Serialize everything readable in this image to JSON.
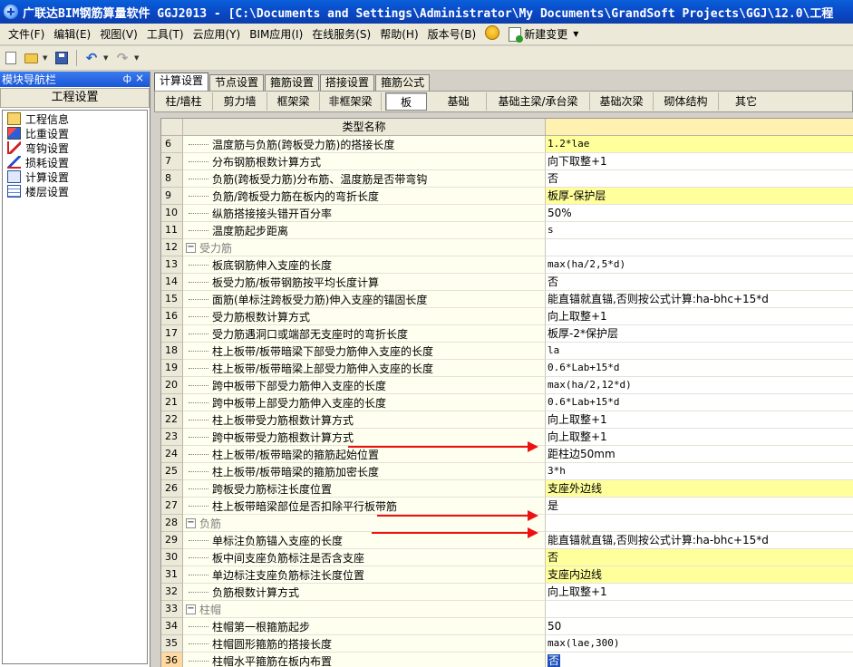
{
  "window": {
    "title": "广联达BIM钢筋算量软件 GGJ2013 - [C:\\Documents and Settings\\Administrator\\My Documents\\GrandSoft Projects\\GGJ\\12.0\\工程"
  },
  "menu": {
    "items": [
      "文件(F)",
      "编辑(E)",
      "视图(V)",
      "工具(T)",
      "云应用(Y)",
      "BIM应用(I)",
      "在线服务(S)",
      "帮助(H)",
      "版本号(B)"
    ],
    "new_change": "新建变更"
  },
  "left_panel": {
    "title": "模块导航栏",
    "pin_glyph": "ф",
    "close_glyph": "×",
    "section": "工程设置",
    "items": [
      "工程信息",
      "比重设置",
      "弯钩设置",
      "损耗设置",
      "计算设置",
      "楼层设置"
    ]
  },
  "tabs": [
    "计算设置",
    "节点设置",
    "箍筋设置",
    "搭接设置",
    "箍筋公式"
  ],
  "subtabs": [
    "柱/墙柱",
    "剪力墙",
    "框架梁",
    "非框架梁",
    "板",
    "基础",
    "基础主梁/承台梁",
    "基础次梁",
    "砌体结构",
    "其它"
  ],
  "grid": {
    "header_name": "类型名称",
    "rows": [
      {
        "n": "6",
        "name": "温度筋与负筋(跨板受力筋)的搭接长度",
        "value": "1.2*lae",
        "hl": true,
        "mono": true
      },
      {
        "n": "7",
        "name": "分布钢筋根数计算方式",
        "value": "向下取整+1"
      },
      {
        "n": "8",
        "name": "负筋(跨板受力筋)分布筋、温度筋是否带弯钩",
        "value": "否"
      },
      {
        "n": "9",
        "name": "负筋/跨板受力筋在板内的弯折长度",
        "value": "板厚-保护层",
        "hl": true
      },
      {
        "n": "10",
        "name": "纵筋搭接接头错开百分率",
        "value": "50%"
      },
      {
        "n": "11",
        "name": "温度筋起步距离",
        "value": "s",
        "mono": true
      },
      {
        "n": "12",
        "name": "受力筋",
        "value": "",
        "group": true
      },
      {
        "n": "13",
        "name": "板底钢筋伸入支座的长度",
        "value": "max(ha/2,5*d)",
        "mono": true
      },
      {
        "n": "14",
        "name": "板受力筋/板带钢筋按平均长度计算",
        "value": "否"
      },
      {
        "n": "15",
        "name": "面筋(单标注跨板受力筋)伸入支座的锚固长度",
        "value": "能直锚就直锚,否则按公式计算:ha-bhc+15*d"
      },
      {
        "n": "16",
        "name": "受力筋根数计算方式",
        "value": "向上取整+1"
      },
      {
        "n": "17",
        "name": "受力筋遇洞口或端部无支座时的弯折长度",
        "value": "板厚-2*保护层"
      },
      {
        "n": "18",
        "name": "柱上板带/板带暗梁下部受力筋伸入支座的长度",
        "value": "la",
        "mono": true
      },
      {
        "n": "19",
        "name": "柱上板带/板带暗梁上部受力筋伸入支座的长度",
        "value": "0.6*Lab+15*d",
        "mono": true
      },
      {
        "n": "20",
        "name": "跨中板带下部受力筋伸入支座的长度",
        "value": "max(ha/2,12*d)",
        "mono": true
      },
      {
        "n": "21",
        "name": "跨中板带上部受力筋伸入支座的长度",
        "value": "0.6*Lab+15*d",
        "mono": true
      },
      {
        "n": "22",
        "name": "柱上板带受力筋根数计算方式",
        "value": "向上取整+1"
      },
      {
        "n": "23",
        "name": "跨中板带受力筋根数计算方式",
        "value": "向上取整+1"
      },
      {
        "n": "24",
        "name": "柱上板带/板带暗梁的箍筋起始位置",
        "value": "距柱边50mm"
      },
      {
        "n": "25",
        "name": "柱上板带/板带暗梁的箍筋加密长度",
        "value": "3*h",
        "mono": true
      },
      {
        "n": "26",
        "name": "跨板受力筋标注长度位置",
        "value": "支座外边线",
        "hl": true
      },
      {
        "n": "27",
        "name": "柱上板带暗梁部位是否扣除平行板带筋",
        "value": "是"
      },
      {
        "n": "28",
        "name": "负筋",
        "value": "",
        "group": true
      },
      {
        "n": "29",
        "name": "单标注负筋锚入支座的长度",
        "value": "能直锚就直锚,否则按公式计算:ha-bhc+15*d"
      },
      {
        "n": "30",
        "name": "板中间支座负筋标注是否含支座",
        "value": "否",
        "hl": true
      },
      {
        "n": "31",
        "name": "单边标注支座负筋标注长度位置",
        "value": "支座内边线",
        "hl": true
      },
      {
        "n": "32",
        "name": "负筋根数计算方式",
        "value": "向上取整+1"
      },
      {
        "n": "33",
        "name": "柱帽",
        "value": "",
        "group": true
      },
      {
        "n": "34",
        "name": "柱帽第一根箍筋起步",
        "value": "50"
      },
      {
        "n": "35",
        "name": "柱帽圆形箍筋的搭接长度",
        "value": "max(lae,300)",
        "mono": true
      },
      {
        "n": "36",
        "name": "柱帽水平箍筋在板内布置",
        "value": "否",
        "current": true
      }
    ]
  }
}
